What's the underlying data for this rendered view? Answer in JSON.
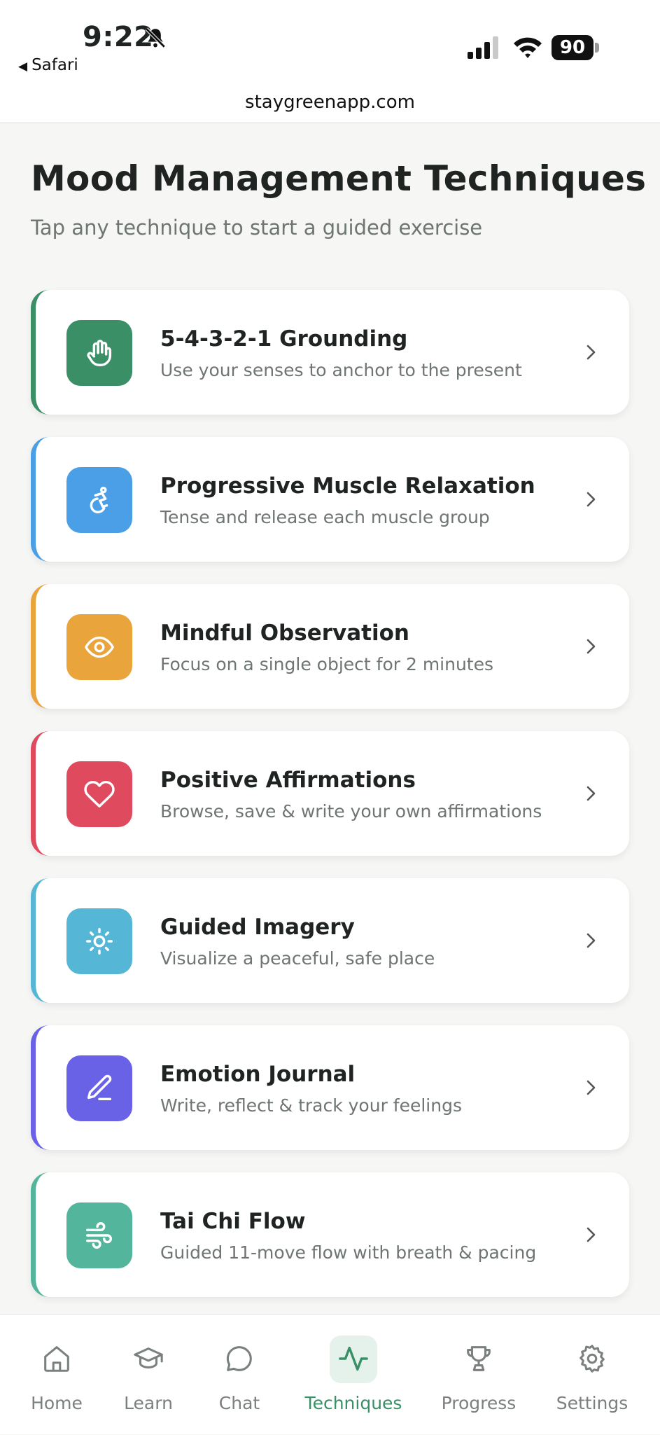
{
  "status_bar": {
    "time": "9:22",
    "back_label": "Safari",
    "battery": "90"
  },
  "browser": {
    "url": "staygreenapp.com"
  },
  "header": {
    "title": "Mood Management Techniques",
    "subtitle": "Tap any technique to start a guided exercise"
  },
  "techniques": [
    {
      "name": "5-4-3-2-1 Grounding",
      "description": "Use your senses to anchor to the present",
      "icon": "hand-icon",
      "color": "#3a8f66"
    },
    {
      "name": "Progressive Muscle Relaxation",
      "description": "Tense and release each muscle group",
      "icon": "accessibility-icon",
      "color": "#4a9fe6"
    },
    {
      "name": "Mindful Observation",
      "description": "Focus on a single object for 2 minutes",
      "icon": "eye-icon",
      "color": "#e9a53c"
    },
    {
      "name": "Positive Affirmations",
      "description": "Browse, save & write your own affirmations",
      "icon": "heart-icon",
      "color": "#e04a5f"
    },
    {
      "name": "Guided Imagery",
      "description": "Visualize a peaceful, safe place",
      "icon": "sun-icon",
      "color": "#55b6d6"
    },
    {
      "name": "Emotion Journal",
      "description": "Write, reflect & track your feelings",
      "icon": "pen-icon",
      "color": "#6a62e6"
    },
    {
      "name": "Tai Chi Flow",
      "description": "Guided 11-move flow with breath & pacing",
      "icon": "wind-icon",
      "color": "#52b59c"
    }
  ],
  "tabs": [
    {
      "label": "Home",
      "icon": "home-icon"
    },
    {
      "label": "Learn",
      "icon": "graduation-cap-icon"
    },
    {
      "label": "Chat",
      "icon": "chat-bubble-icon"
    },
    {
      "label": "Techniques",
      "icon": "activity-icon",
      "active": true
    },
    {
      "label": "Progress",
      "icon": "trophy-icon"
    },
    {
      "label": "Settings",
      "icon": "gear-icon"
    }
  ],
  "colors": {
    "accent": "#3a8f66",
    "muted_text": "#6e7572"
  }
}
